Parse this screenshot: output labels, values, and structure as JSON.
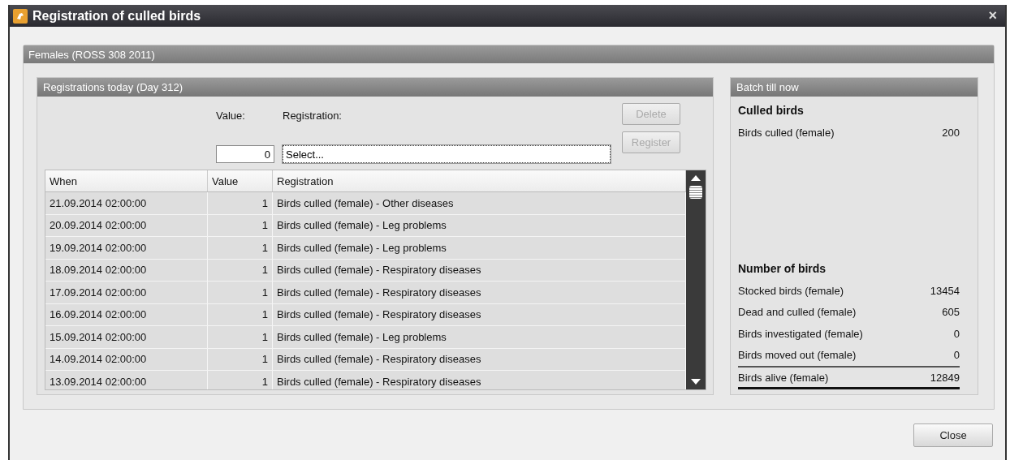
{
  "window": {
    "title": "Registration of culled birds",
    "close": "×"
  },
  "group": {
    "title": "Females (ROSS 308 2011)"
  },
  "registrations": {
    "title": "Registrations today (Day 312)",
    "value_label": "Value:",
    "registration_label": "Registration:",
    "value": "0",
    "registration": "Select...",
    "buttons": [
      {
        "label": "Delete",
        "disabled": true
      },
      {
        "label": "Register",
        "disabled": true
      }
    ],
    "table": {
      "columns": [
        "When",
        "Value",
        "Registration"
      ],
      "rows": [
        {
          "when": "21.09.2014 02:00:00",
          "value": "1",
          "registration": "Birds culled (female) - Other diseases"
        },
        {
          "when": "20.09.2014 02:00:00",
          "value": "1",
          "registration": "Birds culled (female) - Leg problems"
        },
        {
          "when": "19.09.2014 02:00:00",
          "value": "1",
          "registration": "Birds culled (female) - Leg problems"
        },
        {
          "when": "18.09.2014 02:00:00",
          "value": "1",
          "registration": "Birds culled (female) - Respiratory diseases"
        },
        {
          "when": "17.09.2014 02:00:00",
          "value": "1",
          "registration": "Birds culled (female) - Respiratory diseases"
        },
        {
          "when": "16.09.2014 02:00:00",
          "value": "1",
          "registration": "Birds culled (female) - Respiratory diseases"
        },
        {
          "when": "15.09.2014 02:00:00",
          "value": "1",
          "registration": "Birds culled (female) - Leg problems"
        },
        {
          "when": "14.09.2014 02:00:00",
          "value": "1",
          "registration": "Birds culled (female) - Respiratory diseases"
        },
        {
          "when": "13.09.2014 02:00:00",
          "value": "1",
          "registration": "Birds culled (female) - Respiratory diseases"
        }
      ]
    }
  },
  "batch": {
    "title": "Batch till now",
    "sections": [
      {
        "heading": "Culled birds",
        "rows": [
          {
            "label": "Birds culled (female)",
            "value": "200",
            "kind": "item"
          }
        ]
      },
      {
        "heading": "Number of birds",
        "rows": [
          {
            "label": "Stocked birds (female)",
            "value": "13454",
            "kind": "item"
          },
          {
            "label": "Dead and culled (female)",
            "value": "605",
            "kind": "item"
          },
          {
            "label": "Birds investigated (female)",
            "value": "0",
            "kind": "item"
          },
          {
            "label": "Birds moved out (female)",
            "value": "0",
            "kind": "item"
          },
          {
            "label": "Birds alive (female)",
            "value": "12849",
            "kind": "total"
          }
        ]
      }
    ]
  },
  "buttons": [
    {
      "label": "Close"
    }
  ]
}
